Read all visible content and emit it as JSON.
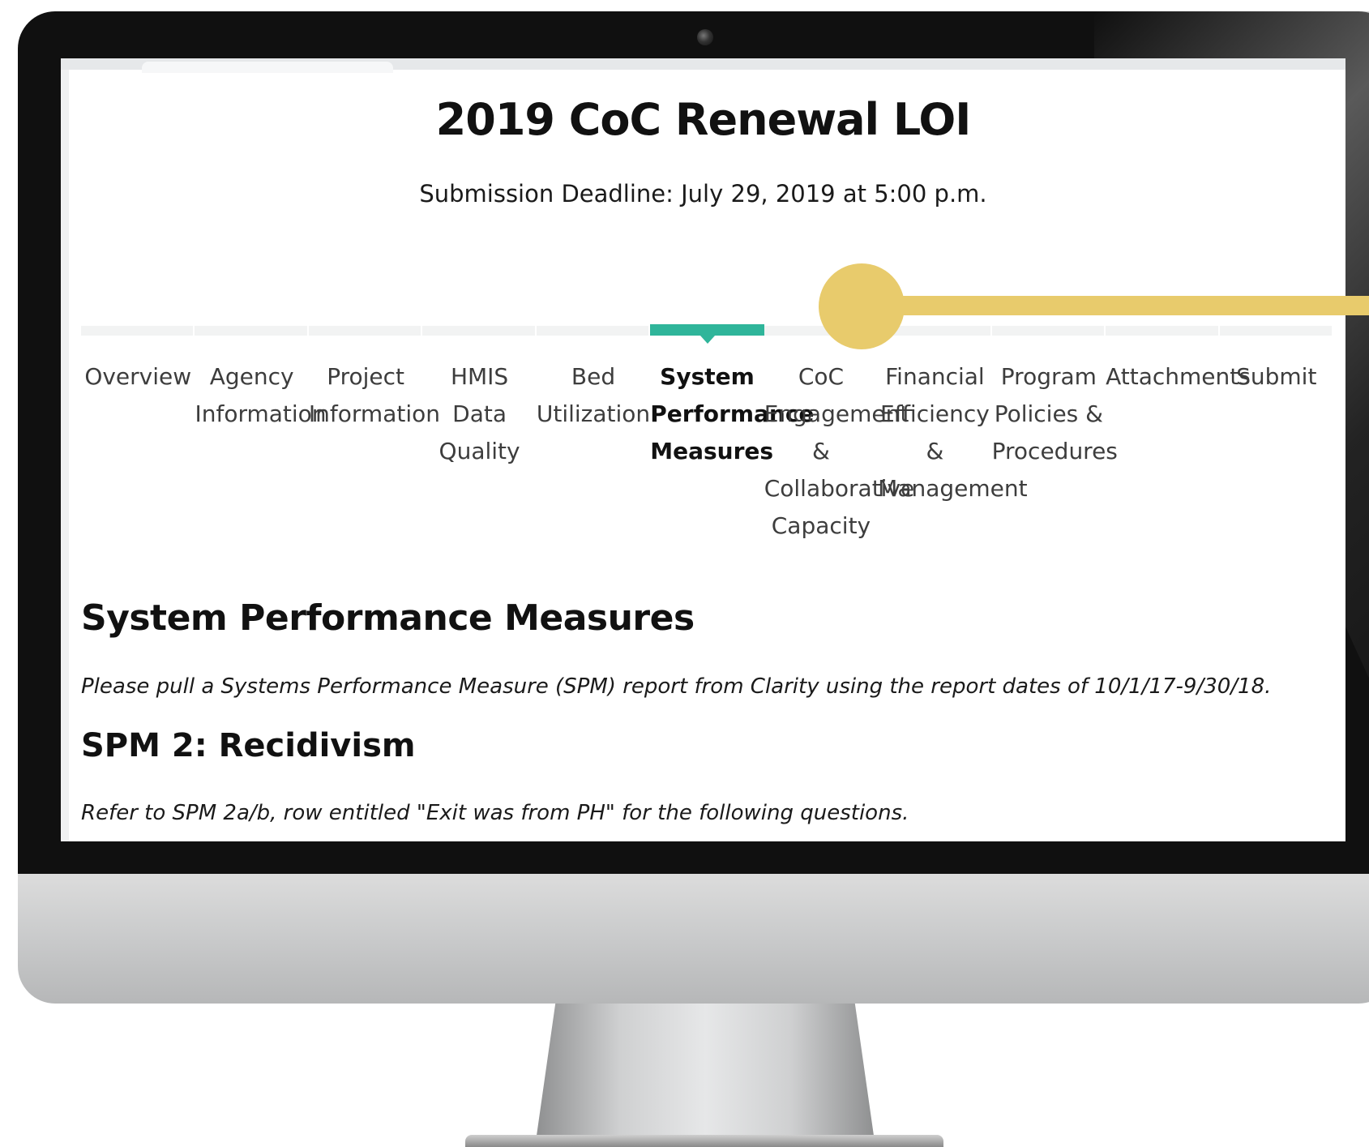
{
  "page": {
    "title": "2019 CoC Renewal LOI",
    "deadline": "Submission Deadline: July 29, 2019 at 5:00 p.m."
  },
  "steps": [
    {
      "label": "Overview",
      "active": false
    },
    {
      "label": "Agency Information",
      "active": false
    },
    {
      "label": "Project Information",
      "active": false
    },
    {
      "label": "HMIS Data Quality",
      "active": false
    },
    {
      "label": "Bed Utilization",
      "active": false
    },
    {
      "label": "System Performance Measures",
      "active": true
    },
    {
      "label": "CoC Engagement & Collaborative Capacity",
      "active": false
    },
    {
      "label": "Financial Efficiency & Management",
      "active": false
    },
    {
      "label": "Program Policies & Procedures",
      "active": false
    },
    {
      "label": "Attachments",
      "active": false
    },
    {
      "label": "Submit",
      "active": false
    }
  ],
  "section": {
    "title": "System Performance Measures",
    "instruction": "Please pull a Systems Performance Measure (SPM) report from Clarity using the report dates of 10/1/17-9/30/18.",
    "subsection_title": "SPM 2: Recidivism",
    "subinstruction": "Refer to SPM 2a/b, row entitled \"Exit was from PH\" for the following questions."
  },
  "colors": {
    "accent": "#2fb59a",
    "callout": "#e8cb6c"
  }
}
